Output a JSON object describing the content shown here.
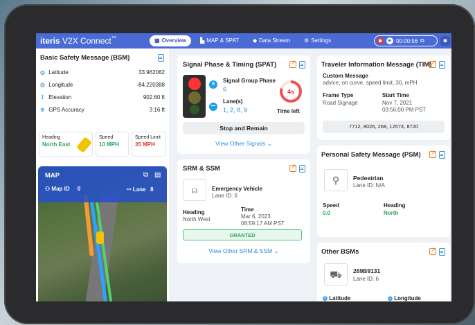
{
  "app": {
    "brand_bold": "iteris",
    "brand_rest": "V2X Connect",
    "brand_mark": "™"
  },
  "tabs": [
    {
      "label": "Overview",
      "icon": "grid-icon",
      "active": true
    },
    {
      "label": "MAP & SPAT",
      "icon": "map-icon",
      "active": false
    },
    {
      "label": "Data Stream",
      "icon": "stream-icon",
      "active": false
    },
    {
      "label": "Settings",
      "icon": "gear-icon",
      "active": false
    }
  ],
  "recorder": {
    "time": "00:00:56"
  },
  "bsm": {
    "title": "Basic Safety Message (BSM)",
    "rows": [
      {
        "label": "Latitude",
        "value": "33.962062",
        "icon": "globe-icon"
      },
      {
        "label": "Longitude",
        "value": "-84.220388",
        "icon": "globe-icon"
      },
      {
        "label": "Elevation",
        "value": "902.60 ft",
        "icon": "elevation-icon"
      },
      {
        "label": "GPS Accuracy",
        "value": "3.16 ft",
        "icon": "gps-icon"
      }
    ],
    "heading": {
      "label": "Heading",
      "value": "North East"
    },
    "speed": {
      "label": "Speed",
      "value": "10 MPH"
    },
    "limit": {
      "label": "Speed Limit",
      "value": "35 MPH"
    }
  },
  "map": {
    "title": "MAP",
    "map_id_label": "Map ID",
    "map_id": "0",
    "lane_label": "Lane",
    "lane": "8"
  },
  "spat": {
    "title": "Signal Phase & Timing (SPAT)",
    "group_label": "Signal Group Phase",
    "group": "6",
    "lanes_label": "Lane(s)",
    "lanes": "1, 2, 8, 9",
    "time": "4s",
    "time_label": "Time left",
    "time_fraction": 0.8,
    "state": "Stop and Remain",
    "link": "View Other Signals"
  },
  "srm": {
    "title": "SRM & SSM",
    "vehicle": "Emergency Vehicle",
    "lane": "Lane ID: 6",
    "heading_label": "Heading",
    "heading": "North West",
    "time_label": "Time",
    "date": "Mar 6, 2023",
    "time": "08:59:17 AM PST",
    "status": "GRANTED",
    "link": "View Other SRM & SSM"
  },
  "tim": {
    "title": "Traveler Information Message (TIM)",
    "custom_label": "Custom Message",
    "custom": "advice, on curve, speed limit, 30, mPH",
    "frame_label": "Frame Type",
    "frame": "Road Signage",
    "start_label": "Start Time",
    "start_date": "Nov 7, 2021",
    "start_time": "03:56:00 PM PST",
    "codes": "7712, 8026, 268, 12574, 8720"
  },
  "psm": {
    "title": "Personal Safety Message (PSM)",
    "type": "Pedestrian",
    "lane": "Lane ID: N/A",
    "speed_label": "Speed",
    "speed": "0.0",
    "heading_label": "Heading",
    "heading": "North"
  },
  "other": {
    "title": "Other BSMs",
    "id": "269B9131",
    "lane": "Lane ID: 6",
    "lat_label": "Latitude",
    "lon_label": "Longitude"
  }
}
